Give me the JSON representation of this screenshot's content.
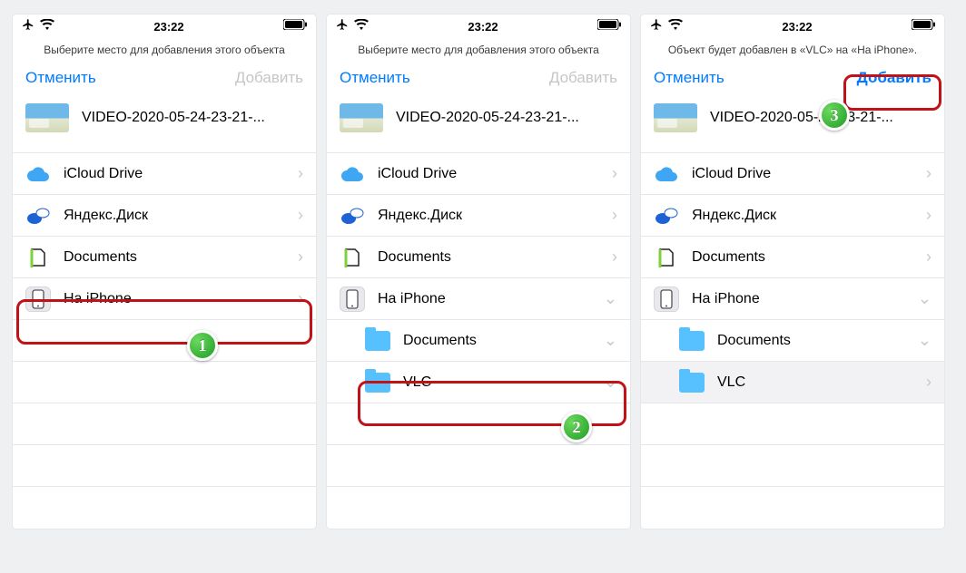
{
  "status": {
    "time": "23:22"
  },
  "screens": [
    {
      "prompt": "Выберите место для добавления этого объекта",
      "cancel": "Отменить",
      "add": "Добавить",
      "add_enabled": false,
      "video_name": "VIDEO-2020-05-24-23-21-...",
      "rows": [
        {
          "id": "icloud",
          "label": "iCloud Drive",
          "chev": "›"
        },
        {
          "id": "yadisk",
          "label": "Яндекс.Диск",
          "chev": "›"
        },
        {
          "id": "docs",
          "label": "Documents",
          "chev": "›"
        },
        {
          "id": "iphone",
          "label": "На iPhone",
          "chev": "›"
        }
      ],
      "highlight": {
        "row": "iphone",
        "step": "1"
      }
    },
    {
      "prompt": "Выберите место для добавления этого объекта",
      "cancel": "Отменить",
      "add": "Добавить",
      "add_enabled": false,
      "video_name": "VIDEO-2020-05-24-23-21-...",
      "rows": [
        {
          "id": "icloud",
          "label": "iCloud Drive",
          "chev": "›"
        },
        {
          "id": "yadisk",
          "label": "Яндекс.Диск",
          "chev": "›"
        },
        {
          "id": "docs",
          "label": "Documents",
          "chev": "›"
        },
        {
          "id": "iphone",
          "label": "На iPhone",
          "chev": "⌄",
          "expanded": true
        },
        {
          "id": "sub-docs",
          "label": "Documents",
          "chev": "⌄",
          "sub": true
        },
        {
          "id": "sub-vlc",
          "label": "VLC",
          "chev": "⌄",
          "sub": true
        }
      ],
      "highlight": {
        "row": "sub-vlc",
        "step": "2"
      }
    },
    {
      "prompt": "Объект будет добавлен в «VLC» на «На iPhone».",
      "cancel": "Отменить",
      "add": "Добавить",
      "add_enabled": true,
      "video_name": "VIDEO-2020-05-24-23-21-...",
      "rows": [
        {
          "id": "icloud",
          "label": "iCloud Drive",
          "chev": "›"
        },
        {
          "id": "yadisk",
          "label": "Яндекс.Диск",
          "chev": "›"
        },
        {
          "id": "docs",
          "label": "Documents",
          "chev": "›"
        },
        {
          "id": "iphone",
          "label": "На iPhone",
          "chev": "⌄",
          "expanded": true
        },
        {
          "id": "sub-docs",
          "label": "Documents",
          "chev": "⌄",
          "sub": true
        },
        {
          "id": "sub-vlc",
          "label": "VLC",
          "chev": "›",
          "sub": true,
          "selected": true
        }
      ],
      "highlight": {
        "nav": "add",
        "step": "3"
      }
    }
  ]
}
